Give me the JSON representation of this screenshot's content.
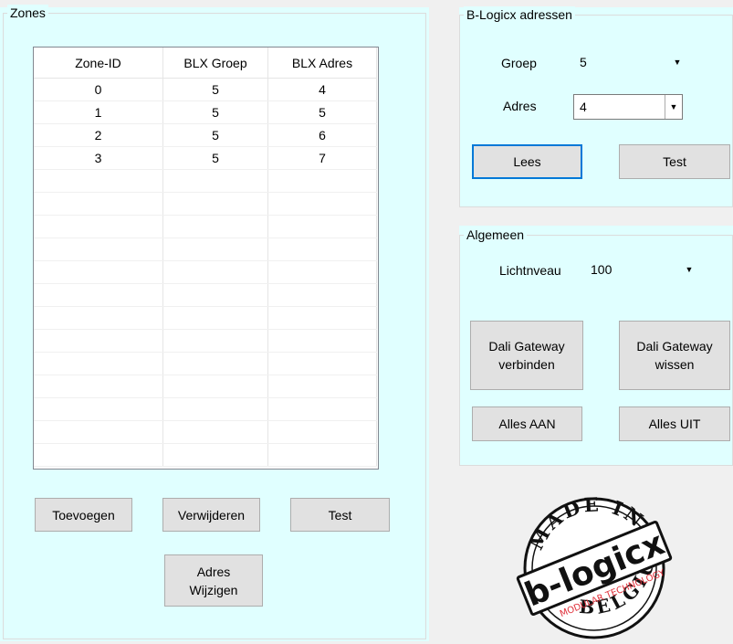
{
  "zones": {
    "title": "Zones",
    "columns": [
      "Zone-ID",
      "BLX Groep",
      "BLX Adres"
    ],
    "rows": [
      [
        "0",
        "5",
        "4"
      ],
      [
        "1",
        "5",
        "5"
      ],
      [
        "2",
        "5",
        "6"
      ],
      [
        "3",
        "5",
        "7"
      ]
    ],
    "buttons": {
      "add": "Toevoegen",
      "remove": "Verwijderen",
      "test": "Test",
      "change_address": "Adres\nWijzigen"
    }
  },
  "blx": {
    "title": "B-Logicx adressen",
    "groep_label": "Groep",
    "groep_value": "5",
    "adres_label": "Adres",
    "adres_value": "4",
    "read_button": "Lees",
    "test_button": "Test"
  },
  "general": {
    "title": "Algemeen",
    "light_label": "Lichtnveau",
    "light_value": "100",
    "connect_button": "Dali Gateway\nverbinden",
    "wipe_button": "Dali Gateway\nwissen",
    "all_on_button": "Alles AAN",
    "all_off_button": "Alles UIT"
  },
  "badge": {
    "top": "MADE IN",
    "brand": "b-logicx",
    "tagline": "MODULAR TECHNOLOGY",
    "bottom": "BELGIUM"
  },
  "colors": {
    "panel": "#e0ffff",
    "button": "#e1e1e1",
    "focus": "#0078d7",
    "badge_red": "#e0303a"
  }
}
